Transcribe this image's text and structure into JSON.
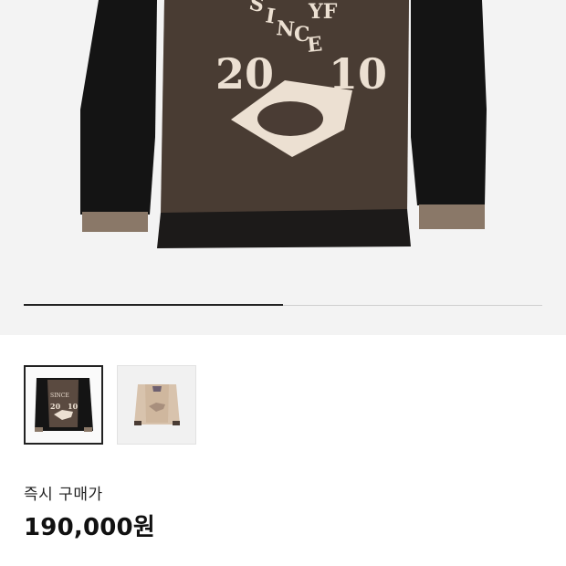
{
  "product": {
    "main_image_alt": "black mesh long sleeve top with 'SINCE 2010' graphic",
    "graphic_text": {
      "arc_top": "YF",
      "arc": "SINCE",
      "year_left": "20",
      "year_right": "10"
    },
    "gallery_progress": 0.5
  },
  "thumbnails": [
    {
      "name": "black",
      "selected": true
    },
    {
      "name": "beige",
      "selected": false
    }
  ],
  "price": {
    "label": "즉시 구매가",
    "value": "190,000원"
  },
  "colors": {
    "hero_bg": "#f3f3f3",
    "garment_black": "#141414",
    "mesh_brown": "#5a4a40",
    "cuff_tan": "#8a7868",
    "print_cream": "#ece0d2"
  }
}
